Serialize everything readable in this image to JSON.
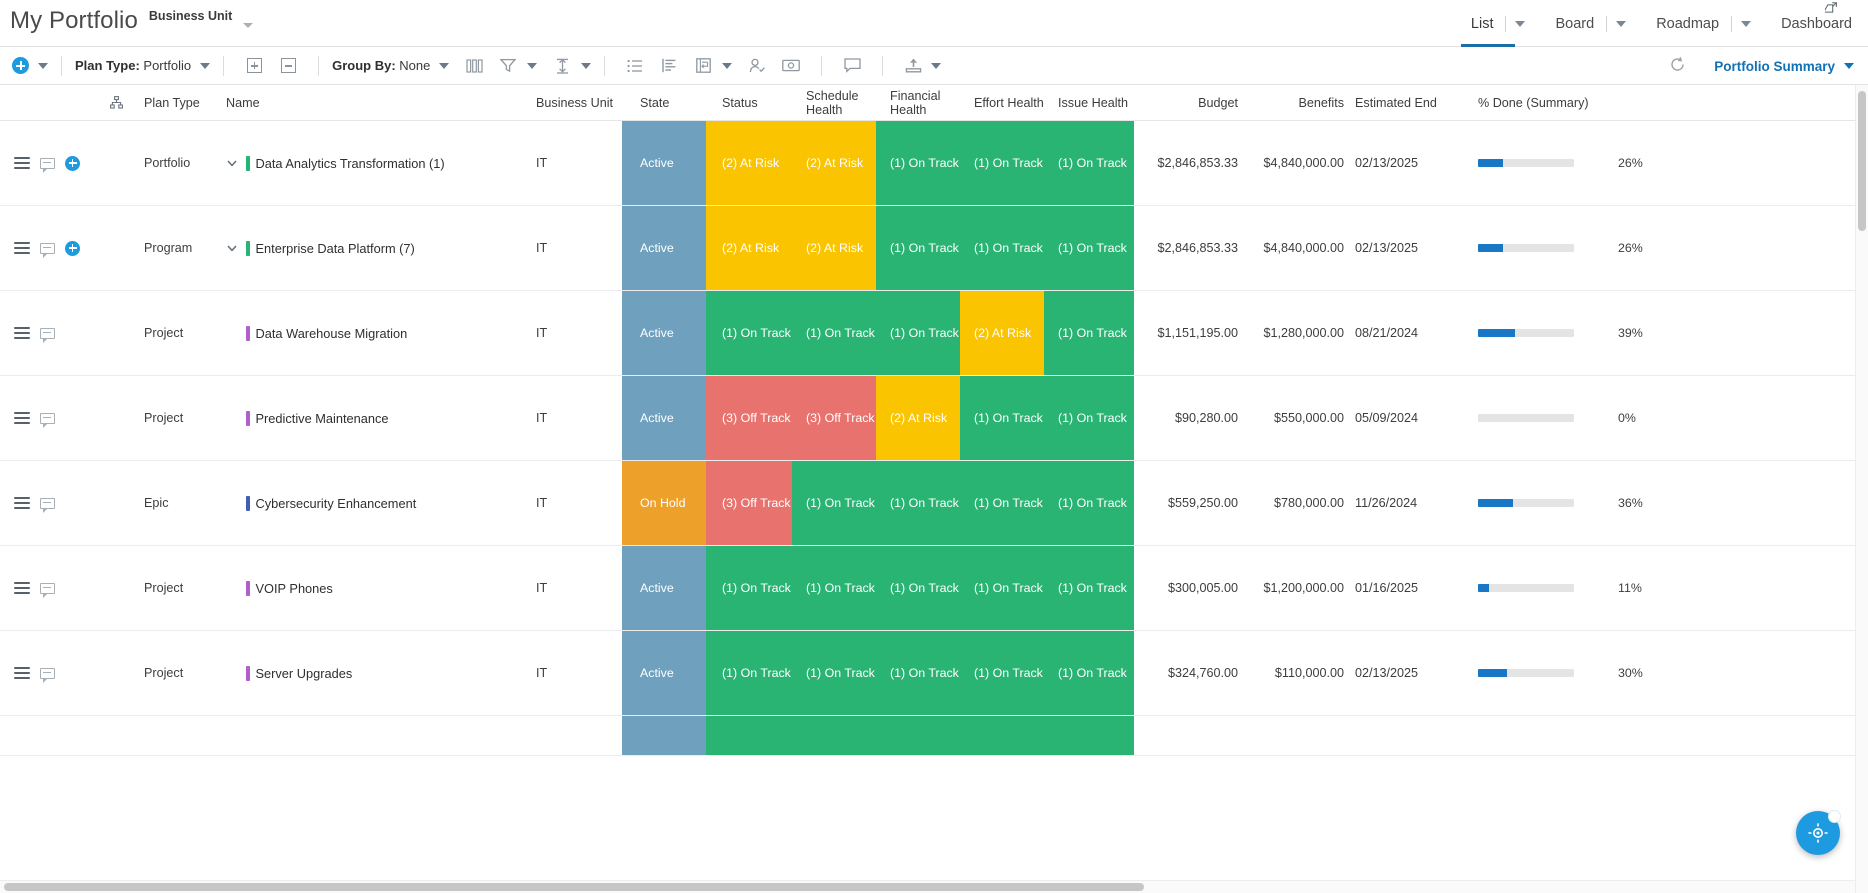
{
  "header": {
    "app_title": "My Portfolio",
    "business_unit_label": "Business Unit",
    "nav": [
      {
        "label": "List",
        "active": true,
        "has_caret": true
      },
      {
        "label": "Board",
        "active": false,
        "has_caret": true
      },
      {
        "label": "Roadmap",
        "active": false,
        "has_caret": true
      },
      {
        "label": "Dashboard",
        "active": false,
        "has_caret": false
      }
    ]
  },
  "toolbar": {
    "add_label": "add-new",
    "plan_type_prefix": "Plan Type:",
    "plan_type_value": "Portfolio",
    "group_by_prefix": "Group By:",
    "group_by_value": "None",
    "icons": [
      "expand-all-icon",
      "collapse-all-icon",
      "columns-icon",
      "filter-icon",
      "row-height-icon",
      "list-view-icon",
      "detail-view-icon",
      "swimlane-icon",
      "assign-user-icon",
      "currency-icon",
      "comment-icon",
      "export-icon"
    ],
    "refresh_label": "refresh",
    "summary_label": "Portfolio Summary"
  },
  "table": {
    "columns": [
      {
        "key": "hierarchy",
        "label": ""
      },
      {
        "key": "plan_type",
        "label": "Plan Type"
      },
      {
        "key": "name",
        "label": "Name"
      },
      {
        "key": "business_unit",
        "label": "Business Unit"
      },
      {
        "key": "state",
        "label": "State"
      },
      {
        "key": "status",
        "label": "Status"
      },
      {
        "key": "schedule_health",
        "label": "Schedule Health"
      },
      {
        "key": "financial_health",
        "label": "Financial Health"
      },
      {
        "key": "effort_health",
        "label": "Effort Health"
      },
      {
        "key": "issue_health",
        "label": "Issue Health"
      },
      {
        "key": "budget",
        "label": "Budget"
      },
      {
        "key": "benefits",
        "label": "Benefits"
      },
      {
        "key": "estimated_end",
        "label": "Estimated End"
      },
      {
        "key": "percent_done",
        "label": "% Done (Summary)"
      }
    ],
    "rows": [
      {
        "plan_type": "Portfolio",
        "name": "Data Analytics Transformation (1)",
        "name_bar_color": "#21b573",
        "has_chevron": true,
        "has_add": true,
        "business_unit": "IT",
        "state": "Active",
        "state_color": "#6fa0bd",
        "status": "(2) At Risk",
        "status_color": "#fbc400",
        "schedule_health": "(2) At Risk",
        "schedule_health_color": "#fbc400",
        "financial_health": "(1) On Track",
        "financial_health_color": "#29b473",
        "effort_health": "(1) On Track",
        "effort_health_color": "#29b473",
        "issue_health": "(1) On Track",
        "issue_health_color": "#29b473",
        "budget": "$2,846,853.33",
        "benefits": "$4,840,000.00",
        "estimated_end": "02/13/2025",
        "percent_done": 26,
        "percent_done_label": "26%"
      },
      {
        "plan_type": "Program",
        "name": "Enterprise Data Platform (7)",
        "name_bar_color": "#29b473",
        "has_chevron": true,
        "has_add": true,
        "business_unit": "IT",
        "state": "Active",
        "state_color": "#6fa0bd",
        "status": "(2) At Risk",
        "status_color": "#fbc400",
        "schedule_health": "(2) At Risk",
        "schedule_health_color": "#fbc400",
        "financial_health": "(1) On Track",
        "financial_health_color": "#29b473",
        "effort_health": "(1) On Track",
        "effort_health_color": "#29b473",
        "issue_health": "(1) On Track",
        "issue_health_color": "#29b473",
        "budget": "$2,846,853.33",
        "benefits": "$4,840,000.00",
        "estimated_end": "02/13/2025",
        "percent_done": 26,
        "percent_done_label": "26%"
      },
      {
        "plan_type": "Project",
        "name": "Data Warehouse Migration",
        "name_bar_color": "#b05fc9",
        "has_chevron": false,
        "has_add": false,
        "business_unit": "IT",
        "state": "Active",
        "state_color": "#6fa0bd",
        "status": "(1) On Track",
        "status_color": "#29b473",
        "schedule_health": "(1) On Track",
        "schedule_health_color": "#29b473",
        "financial_health": "(1) On Track",
        "financial_health_color": "#29b473",
        "effort_health": "(2) At Risk",
        "effort_health_color": "#fbc400",
        "issue_health": "(1) On Track",
        "issue_health_color": "#29b473",
        "budget": "$1,151,195.00",
        "benefits": "$1,280,000.00",
        "estimated_end": "08/21/2024",
        "percent_done": 39,
        "percent_done_label": "39%"
      },
      {
        "plan_type": "Project",
        "name": "Predictive Maintenance",
        "name_bar_color": "#b05fc9",
        "has_chevron": false,
        "has_add": false,
        "business_unit": "IT",
        "state": "Active",
        "state_color": "#6fa0bd",
        "status": "(3) Off Track",
        "status_color": "#e8726e",
        "schedule_health": "(3) Off Track",
        "schedule_health_color": "#e8726e",
        "financial_health": "(2) At Risk",
        "financial_health_color": "#fbc400",
        "effort_health": "(1) On Track",
        "effort_health_color": "#29b473",
        "issue_health": "(1) On Track",
        "issue_health_color": "#29b473",
        "budget": "$90,280.00",
        "benefits": "$550,000.00",
        "estimated_end": "05/09/2024",
        "percent_done": 0,
        "percent_done_label": "0%"
      },
      {
        "plan_type": "Epic",
        "name": "Cybersecurity Enhancement",
        "name_bar_color": "#3f5fb0",
        "has_chevron": false,
        "has_add": false,
        "business_unit": "IT",
        "state": "On Hold",
        "state_color": "#eda12a",
        "status": "(3) Off Track",
        "status_color": "#e8726e",
        "schedule_health": "(1) On Track",
        "schedule_health_color": "#29b473",
        "financial_health": "(1) On Track",
        "financial_health_color": "#29b473",
        "effort_health": "(1) On Track",
        "effort_health_color": "#29b473",
        "issue_health": "(1) On Track",
        "issue_health_color": "#29b473",
        "budget": "$559,250.00",
        "benefits": "$780,000.00",
        "estimated_end": "11/26/2024",
        "percent_done": 36,
        "percent_done_label": "36%"
      },
      {
        "plan_type": "Project",
        "name": "VOIP Phones",
        "name_bar_color": "#b05fc9",
        "has_chevron": false,
        "has_add": false,
        "business_unit": "IT",
        "state": "Active",
        "state_color": "#6fa0bd",
        "status": "(1) On Track",
        "status_color": "#29b473",
        "schedule_health": "(1) On Track",
        "schedule_health_color": "#29b473",
        "financial_health": "(1) On Track",
        "financial_health_color": "#29b473",
        "effort_health": "(1) On Track",
        "effort_health_color": "#29b473",
        "issue_health": "(1) On Track",
        "issue_health_color": "#29b473",
        "budget": "$300,005.00",
        "benefits": "$1,200,000.00",
        "estimated_end": "01/16/2025",
        "percent_done": 11,
        "percent_done_label": "11%"
      },
      {
        "plan_type": "Project",
        "name": "Server Upgrades",
        "name_bar_color": "#b05fc9",
        "has_chevron": false,
        "has_add": false,
        "business_unit": "IT",
        "state": "Active",
        "state_color": "#6fa0bd",
        "status": "(1) On Track",
        "status_color": "#29b473",
        "schedule_health": "(1) On Track",
        "schedule_health_color": "#29b473",
        "financial_health": "(1) On Track",
        "financial_health_color": "#29b473",
        "effort_health": "(1) On Track",
        "effort_health_color": "#29b473",
        "issue_health": "(1) On Track",
        "issue_health_color": "#29b473",
        "budget": "$324,760.00",
        "benefits": "$110,000.00",
        "estimated_end": "02/13/2025",
        "percent_done": 30,
        "percent_done_label": "30%"
      },
      {
        "plan_type": "",
        "name": "",
        "name_bar_color": "#ffffff",
        "has_chevron": false,
        "has_add": false,
        "business_unit": "",
        "state": "",
        "state_color": "#6fa0bd",
        "status": "",
        "status_color": "#29b473",
        "schedule_health": "",
        "schedule_health_color": "#29b473",
        "financial_health": "",
        "financial_health_color": "#29b473",
        "effort_health": "",
        "effort_health_color": "#29b473",
        "issue_health": "",
        "issue_health_color": "#29b473",
        "budget": "",
        "benefits": "",
        "estimated_end": "",
        "percent_done": 0,
        "percent_done_label": ""
      }
    ]
  },
  "fab": {
    "name": "help-assistant-button",
    "badge": ""
  }
}
